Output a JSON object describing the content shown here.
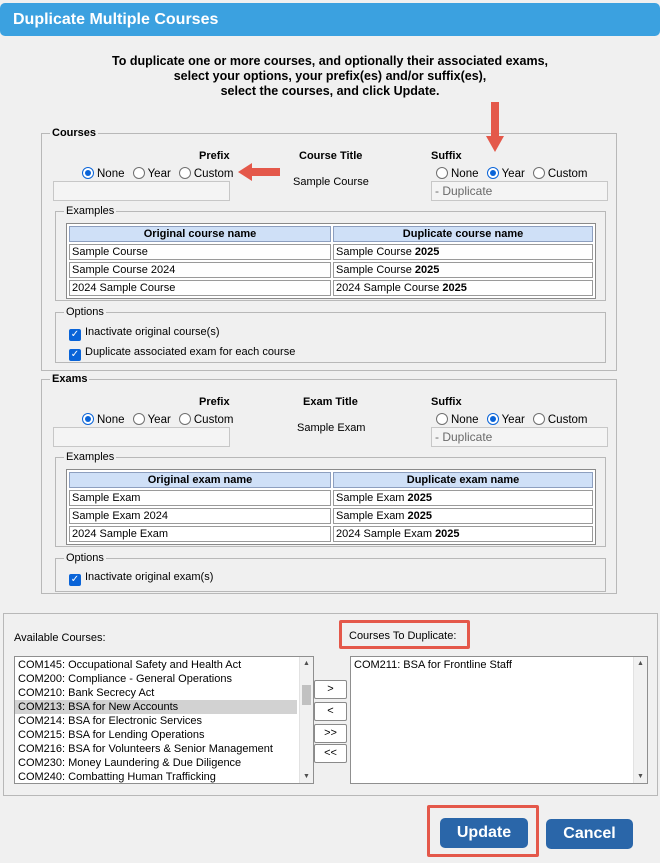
{
  "dialog": {
    "title": "Duplicate Multiple Courses",
    "intro": [
      "To duplicate one or more courses, and optionally their associated exams,",
      "select your options, your prefix(es) and/or suffix(es),",
      "select the courses, and click Update."
    ]
  },
  "courses": {
    "legend": "Courses",
    "prefix_label": "Prefix",
    "title_label": "Course Title",
    "suffix_label": "Suffix",
    "sample_title": "Sample Course",
    "radio_none": "None",
    "radio_year": "Year",
    "radio_custom": "Custom",
    "prefix_selected": "None",
    "suffix_selected": "Year",
    "prefix_value": "",
    "suffix_value": "- Duplicate",
    "examples_legend": "Examples",
    "col_original": "Original course name",
    "col_duplicate": "Duplicate course name",
    "rows": [
      {
        "original": "Sample Course",
        "dup_base": "Sample Course ",
        "dup_suffix": "2025"
      },
      {
        "original": "Sample Course 2024",
        "dup_base": "Sample Course ",
        "dup_suffix": "2025"
      },
      {
        "original": "2024 Sample Course",
        "dup_base": "2024 Sample Course ",
        "dup_suffix": "2025"
      }
    ],
    "options_legend": "Options",
    "opt_inactivate": "Inactivate original course(s)",
    "opt_inactivate_checked": true,
    "opt_dup_exam": "Duplicate associated exam for each course",
    "opt_dup_exam_checked": true
  },
  "exams": {
    "legend": "Exams",
    "prefix_label": "Prefix",
    "title_label": "Exam Title",
    "suffix_label": "Suffix",
    "sample_title": "Sample Exam",
    "radio_none": "None",
    "radio_year": "Year",
    "radio_custom": "Custom",
    "prefix_selected": "None",
    "suffix_selected": "Year",
    "prefix_value": "",
    "suffix_value": "- Duplicate",
    "examples_legend": "Examples",
    "col_original": "Original exam name",
    "col_duplicate": "Duplicate exam name",
    "rows": [
      {
        "original": "Sample Exam",
        "dup_base": "Sample Exam ",
        "dup_suffix": "2025"
      },
      {
        "original": "Sample Exam 2024",
        "dup_base": "Sample Exam ",
        "dup_suffix": "2025"
      },
      {
        "original": "2024 Sample Exam",
        "dup_base": "2024 Sample Exam ",
        "dup_suffix": "2025"
      }
    ],
    "options_legend": "Options",
    "opt_inactivate": "Inactivate original exam(s)",
    "opt_inactivate_checked": true
  },
  "selection": {
    "available_label": "Available Courses:",
    "available": [
      "COM145: Occupational Safety and Health Act",
      "COM200: Compliance - General Operations",
      "COM210: Bank Secrecy Act",
      "COM213: BSA for New Accounts",
      "COM214: BSA for Electronic Services",
      "COM215: BSA for Lending Operations",
      "COM216: BSA for Volunteers & Senior Management",
      "COM230: Money Laundering & Due Diligence",
      "COM240: Combatting Human Trafficking"
    ],
    "available_selected": "COM213: BSA for New Accounts",
    "to_duplicate_label": "Courses To Duplicate:",
    "to_duplicate": [
      "COM211: BSA for Frontline Staff"
    ],
    "move_right": ">",
    "move_left": "<",
    "move_all_right": ">>",
    "move_all_left": "<<"
  },
  "actions": {
    "update": "Update",
    "cancel": "Cancel"
  },
  "colors": {
    "title_bar": "#3ba1e0",
    "button": "#2a66a9",
    "annotation": "#e4584a",
    "radio_checked": "#0a64d8"
  }
}
